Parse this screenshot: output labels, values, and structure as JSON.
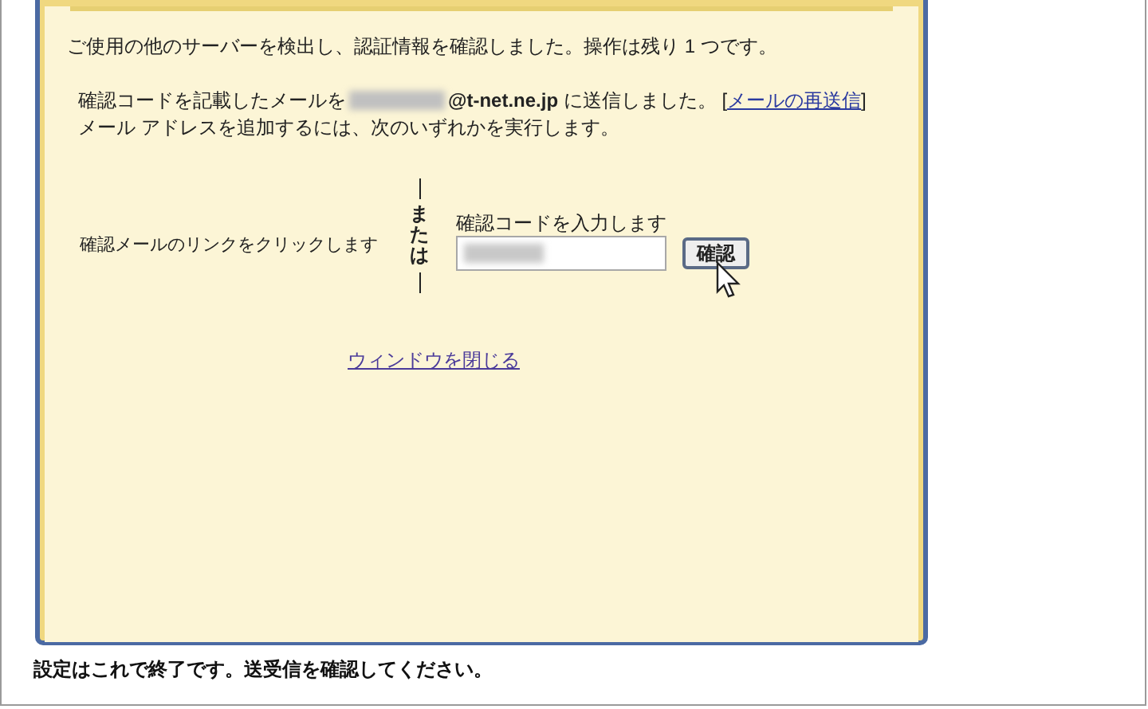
{
  "dialog": {
    "status": "ご使用の他のサーバーを検出し、認証情報を確認しました。操作は残り 1 つです。",
    "sent_before": "確認コードを記載したメールを",
    "sent_after": "**@t-net.ne.jp** に送信しました。 [",
    "resend_link": "メールの再送信",
    "sent_close": "]",
    "instruction": "メール アドレスを追加するには、次のいずれかを実行します。",
    "option_link": "確認メールのリンクをクリックします",
    "or_label": "または",
    "code_label": "確認コードを入力します",
    "confirm_button": "確認",
    "close_link": "ウィンドウを閉じる"
  },
  "footer": "設定はこれで終了です。送受信を確認してください。"
}
